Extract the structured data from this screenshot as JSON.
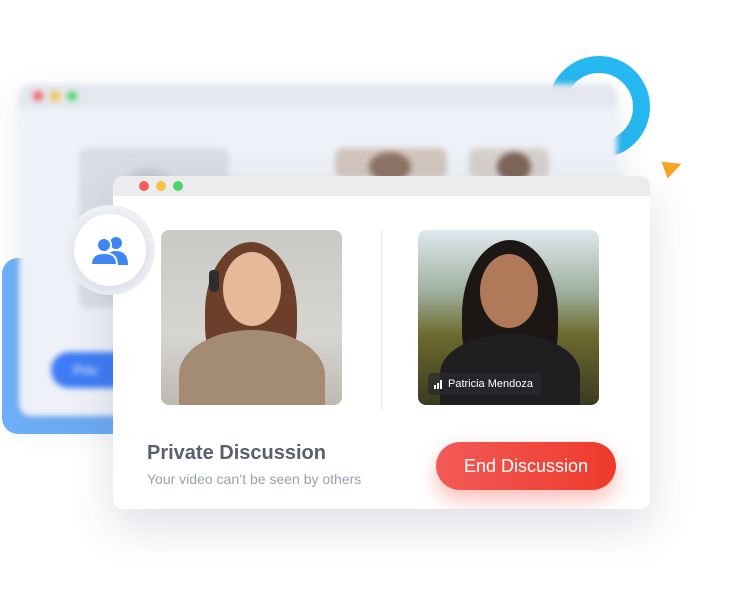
{
  "colors": {
    "accent_blue": "#26b8f0",
    "accent_orange": "#f5a623",
    "end_button": "#ee3a2b",
    "group_icon": "#3f86f4"
  },
  "back_window": {
    "button_label": "Priv"
  },
  "main_window": {
    "participants": [
      {
        "name": ""
      },
      {
        "name": "Patricia Mendoza",
        "signal_icon": "signal-bars-icon"
      }
    ],
    "title": "Private Discussion",
    "subtitle": "Your video can’t be seen by others",
    "end_button_label": "End Discussion"
  },
  "group_icon": "users-group-icon"
}
